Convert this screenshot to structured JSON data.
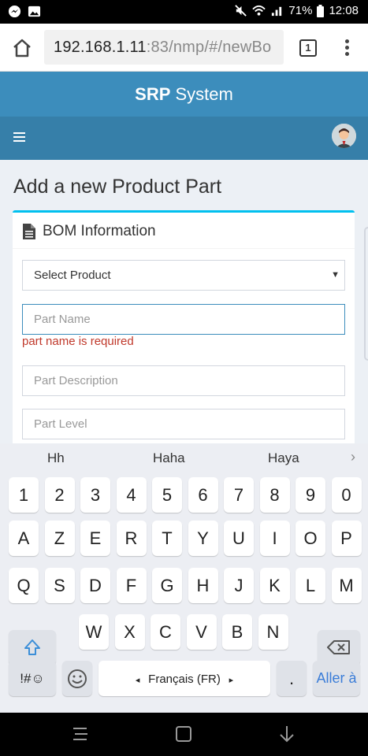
{
  "status_bar": {
    "battery": "71%",
    "time": "12:08"
  },
  "browser": {
    "url_host": "192.168.1.11",
    "url_path": ":83/nmp/#/newBo",
    "tab_count": "1"
  },
  "app": {
    "title_bold": "SRP",
    "title_rest": " System"
  },
  "page": {
    "title": "Add a new Product Part",
    "box_title": "BOM Information",
    "select_product": "Select Product",
    "part_name_placeholder": "Part Name",
    "part_name_error": "part name is required",
    "part_description_placeholder": "Part Description",
    "part_level_placeholder": "Part Level"
  },
  "keyboard": {
    "suggestions": [
      "Hh",
      "Haha",
      "Haya"
    ],
    "row_numbers": [
      "1",
      "2",
      "3",
      "4",
      "5",
      "6",
      "7",
      "8",
      "9",
      "0"
    ],
    "row1": [
      "A",
      "Z",
      "E",
      "R",
      "T",
      "Y",
      "U",
      "I",
      "O",
      "P"
    ],
    "row2": [
      "Q",
      "S",
      "D",
      "F",
      "G",
      "H",
      "J",
      "K",
      "L",
      "M"
    ],
    "row3": [
      "W",
      "X",
      "C",
      "V",
      "B",
      "N"
    ],
    "symbols_label": "!#☺",
    "space_label": "Français (FR)",
    "period_label": ".",
    "enter_label": "Aller à"
  },
  "colors": {
    "header": "#3c8dbc",
    "nav": "#367fa9",
    "box_accent": "#00c0ef",
    "error": "#c0392b"
  }
}
